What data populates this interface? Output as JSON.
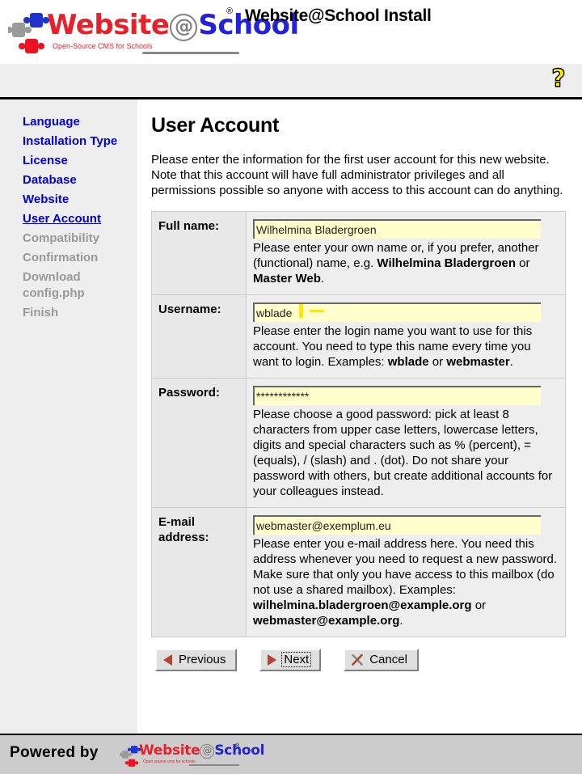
{
  "header": {
    "title": "Website@School Install",
    "logo": {
      "word_1": "Website",
      "at": "@",
      "word_2": "School",
      "tagline": "Open-Source CMS for Schools",
      "registered_mark": "®"
    }
  },
  "toolbar": {
    "help_icon": "question-mark-help-icon",
    "help_glyph": "?"
  },
  "sidebar": {
    "items": [
      {
        "label": "Language",
        "state": "done"
      },
      {
        "label": "Installation Type",
        "state": "done"
      },
      {
        "label": "License",
        "state": "done"
      },
      {
        "label": "Database",
        "state": "done"
      },
      {
        "label": "Website",
        "state": "done"
      },
      {
        "label": "User Account",
        "state": "current"
      },
      {
        "label": "Compatibility",
        "state": "disabled"
      },
      {
        "label": "Confirmation",
        "state": "disabled"
      },
      {
        "label": "Download config.php",
        "state": "disabled"
      },
      {
        "label": "Finish",
        "state": "disabled"
      }
    ]
  },
  "main": {
    "page_title": "User Account",
    "intro": "Please enter the information for the first user account for this new website. Note that this account will have full administrator privileges and all permissions possible so anyone with access to this account can do anything.",
    "fields": {
      "fullname": {
        "label": "Full name:",
        "value": "Wilhelmina Bladergroen",
        "help_1": "Please enter your own name or, if you prefer, another (functional) name, e.g. ",
        "help_b1": "Wilhelmina Bladergroen",
        "help_2": " or ",
        "help_b2": "Master Web",
        "help_3": "."
      },
      "username": {
        "label": "Username:",
        "value": "wblade",
        "help_1": "Please enter the login name you want to use for this account. You need to type this name every time you want to login. Examples: ",
        "help_b1": "wblade",
        "help_2": " or ",
        "help_b2": "webmaster",
        "help_3": "."
      },
      "password": {
        "label": "Password:",
        "value": "************",
        "help_1": "Please choose a good password: pick at least 8 characters from upper case letters, lowercase letters, digits and special characters such as % (percent), = (equals), / (slash) and . (dot). Do not share your password with others, but create additional accounts for your colleagues instead.",
        "help_b1": "",
        "help_2": "",
        "help_b2": "",
        "help_3": ""
      },
      "email": {
        "label": "E-mail address:",
        "value": "webmaster@exemplum.eu",
        "help_1": "Please enter you e-mail address here. You need this address whenever you need to request a new password. Make sure that only you have access to this mailbox (do not use a shared mailbox). Examples: ",
        "help_b1": "wilhelmina.bladergroen@example.org",
        "help_2": " or ",
        "help_b2": "webmaster@example.org",
        "help_3": "."
      }
    },
    "buttons": {
      "previous": {
        "label": "Previous",
        "icon": "triangle-left-icon",
        "focused": false
      },
      "next": {
        "label": "Next",
        "icon": "triangle-right-icon",
        "focused": true
      },
      "cancel": {
        "label": "Cancel",
        "icon": "x-cross-icon",
        "focused": false
      }
    }
  },
  "footer": {
    "powered_by": "Powered by",
    "logo": {
      "word_1": "Website",
      "at": "@",
      "word_2": "School",
      "tagline": "Open source cms for schools",
      "registered_mark": "®"
    }
  },
  "colors": {
    "logo_red": "#e8202a",
    "logo_blue": "#2222dd",
    "logo_gray": "#808080",
    "link_blue": "#0000dd",
    "disabled_gray": "#999999",
    "input_yellow": "#ffffcc",
    "sidebar_gray": "#eeeeee",
    "footer_gray": "#cccccc",
    "help_yellow": "#ffe800",
    "button_icon_red": "#b4452a"
  }
}
